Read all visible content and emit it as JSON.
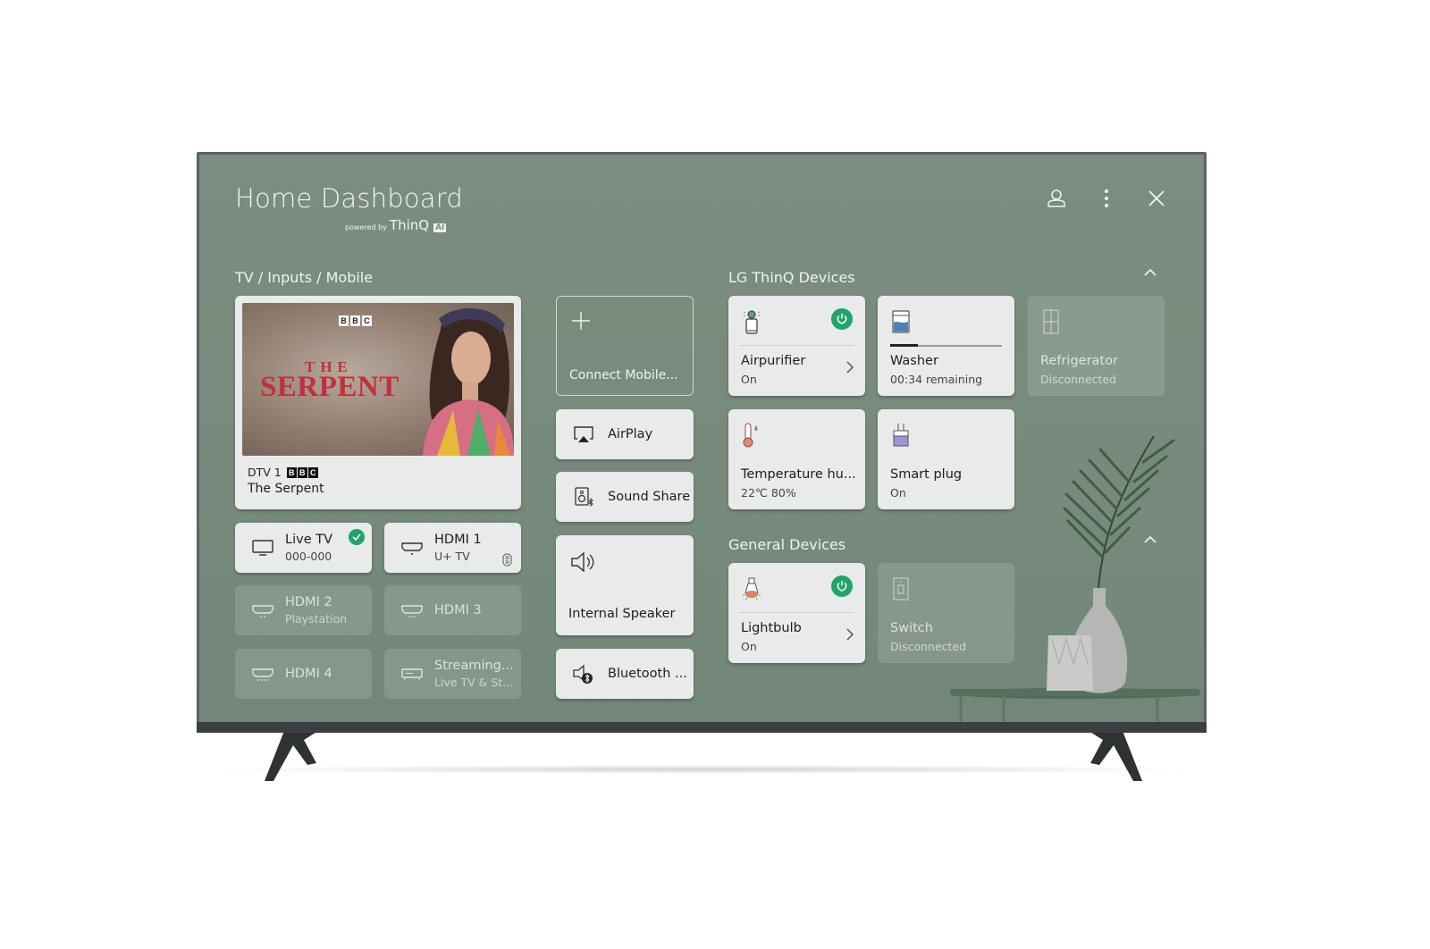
{
  "header": {
    "title": "Home Dashboard",
    "powered_by_prefix": "powered by",
    "powered_by_brand": "ThinQ",
    "powered_by_badge": "AI",
    "icons": [
      "profile-icon",
      "more-options-icon",
      "close-icon"
    ]
  },
  "sections": {
    "tv_inputs": {
      "label": "TV / Inputs / Mobile"
    },
    "thinq": {
      "label": "LG ThinQ Devices",
      "collapse_icon": "chevron-up-icon"
    },
    "general": {
      "label": "General Devices",
      "collapse_icon": "chevron-up-icon"
    }
  },
  "now_playing": {
    "poster_brand": "BBC",
    "poster_title_small": "THE",
    "poster_title_large": "SERPENT",
    "channel": "DTV 1",
    "channel_brand": "BBC",
    "program": "The Serpent"
  },
  "inputs": [
    {
      "name": "Live TV",
      "sub": "000-000",
      "icon": "tv-icon",
      "active": true,
      "selected": true,
      "status_icon": "check-icon"
    },
    {
      "name": "HDMI 1",
      "sub": "U+ TV",
      "icon": "hdmi-icon",
      "active": true,
      "status_icon": "remote-icon"
    },
    {
      "name": "HDMI 2",
      "sub": "Playstation",
      "icon": "hdmi-icon",
      "active": false
    },
    {
      "name": "HDMI 3",
      "sub": "",
      "icon": "hdmi-icon",
      "active": false
    },
    {
      "name": "HDMI 4",
      "sub": "",
      "icon": "hdmi-icon",
      "active": false
    },
    {
      "name": "Streaming...",
      "sub": "Live TV & St...",
      "icon": "set-top-box-icon",
      "active": false
    }
  ],
  "mobile": {
    "connect_label": "Connect Mobile...",
    "connect_icon": "plus-icon",
    "features": [
      {
        "label": "AirPlay",
        "icon": "airplay-icon"
      },
      {
        "label": "Sound Share",
        "icon": "sound-share-icon"
      },
      {
        "label": "Internal Speaker",
        "icon": "speaker-icon"
      },
      {
        "label": "Bluetooth ...",
        "icon": "bluetooth-speaker-icon"
      }
    ]
  },
  "thinq_devices": [
    {
      "name": "Airpurifier",
      "status": "On",
      "icon": "air-purifier-icon",
      "power_on": true,
      "has_detail": true
    },
    {
      "name": "Washer",
      "status": "00:34 remaining",
      "icon": "washer-icon",
      "progress": 0.25
    },
    {
      "name": "Refrigerator",
      "status": "Disconnected",
      "icon": "refrigerator-icon",
      "connected": false
    },
    {
      "name": "Temperature hu...",
      "status": "22℃ 80%",
      "icon": "thermo-hygrometer-icon"
    },
    {
      "name": "Smart plug",
      "status": "On",
      "icon": "smart-plug-icon"
    }
  ],
  "general_devices": [
    {
      "name": "Lightbulb",
      "status": "On",
      "icon": "lightbulb-icon",
      "power_on": true,
      "has_detail": true
    },
    {
      "name": "Switch",
      "status": "Disconnected",
      "icon": "switch-icon",
      "connected": false
    }
  ],
  "colors": {
    "screen_bg": "#7a8d80",
    "card_bg": "#e9eaea",
    "power_green": "#1fa46a",
    "poster_title_red": "#c2303a"
  }
}
